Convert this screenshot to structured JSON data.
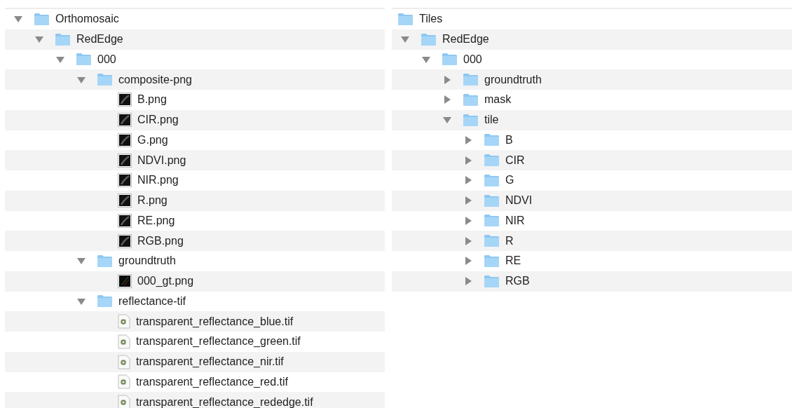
{
  "panels": [
    {
      "items": [
        {
          "name": "Orthomosaic",
          "kind": "folder",
          "expanded": true,
          "children": [
            {
              "name": "RedEdge",
              "kind": "folder",
              "expanded": true,
              "children": [
                {
                  "name": "000",
                  "kind": "folder",
                  "expanded": true,
                  "children": [
                    {
                      "name": "composite-png",
                      "kind": "folder",
                      "expanded": true,
                      "children": [
                        {
                          "name": "B.png",
                          "kind": "image"
                        },
                        {
                          "name": "CIR.png",
                          "kind": "image"
                        },
                        {
                          "name": "G.png",
                          "kind": "image"
                        },
                        {
                          "name": "NDVI.png",
                          "kind": "image"
                        },
                        {
                          "name": "NIR.png",
                          "kind": "image"
                        },
                        {
                          "name": "R.png",
                          "kind": "image"
                        },
                        {
                          "name": "RE.png",
                          "kind": "image"
                        },
                        {
                          "name": "RGB.png",
                          "kind": "image"
                        }
                      ]
                    },
                    {
                      "name": "groundtruth",
                      "kind": "folder",
                      "expanded": true,
                      "children": [
                        {
                          "name": "000_gt.png",
                          "kind": "mask"
                        }
                      ]
                    },
                    {
                      "name": "reflectance-tif",
                      "kind": "folder",
                      "expanded": true,
                      "children": [
                        {
                          "name": "transparent_reflectance_blue.tif",
                          "kind": "tif"
                        },
                        {
                          "name": "transparent_reflectance_green.tif",
                          "kind": "tif"
                        },
                        {
                          "name": "transparent_reflectance_nir.tif",
                          "kind": "tif"
                        },
                        {
                          "name": "transparent_reflectance_red.tif",
                          "kind": "tif"
                        },
                        {
                          "name": "transparent_reflectance_rededge.tif",
                          "kind": "tif"
                        }
                      ]
                    }
                  ]
                }
              ]
            }
          ]
        }
      ]
    },
    {
      "items": [
        {
          "name": "Tiles",
          "kind": "folder",
          "children": [
            {
              "name": "RedEdge",
              "kind": "folder",
              "expanded": true,
              "children": [
                {
                  "name": "000",
                  "kind": "folder",
                  "expanded": true,
                  "children": [
                    {
                      "name": "groundtruth",
                      "kind": "folder",
                      "expanded": false
                    },
                    {
                      "name": "mask",
                      "kind": "folder",
                      "expanded": false
                    },
                    {
                      "name": "tile",
                      "kind": "folder",
                      "expanded": true,
                      "children": [
                        {
                          "name": "B",
                          "kind": "folder",
                          "expanded": false
                        },
                        {
                          "name": "CIR",
                          "kind": "folder",
                          "expanded": false
                        },
                        {
                          "name": "G",
                          "kind": "folder",
                          "expanded": false
                        },
                        {
                          "name": "NDVI",
                          "kind": "folder",
                          "expanded": false
                        },
                        {
                          "name": "NIR",
                          "kind": "folder",
                          "expanded": false
                        },
                        {
                          "name": "R",
                          "kind": "folder",
                          "expanded": false
                        },
                        {
                          "name": "RE",
                          "kind": "folder",
                          "expanded": false
                        },
                        {
                          "name": "RGB",
                          "kind": "folder",
                          "expanded": false
                        }
                      ]
                    }
                  ]
                }
              ]
            }
          ]
        }
      ]
    }
  ]
}
